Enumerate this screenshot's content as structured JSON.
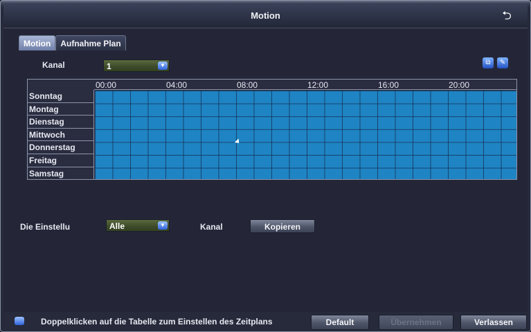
{
  "window": {
    "title": "Motion",
    "back_icon": "return-arrow-icon"
  },
  "tabs": [
    {
      "label": "Motion",
      "active": true
    },
    {
      "label": "Aufnahme Plan",
      "active": false
    }
  ],
  "channel": {
    "label": "Kanal",
    "value": "1"
  },
  "toolbar_icons": [
    "copy-schedule-icon",
    "edit-schedule-icon"
  ],
  "schedule": {
    "time_labels": [
      "00:00",
      "04:00",
      "08:00",
      "12:00",
      "16:00",
      "20:00"
    ],
    "days": [
      "Sonntag",
      "Montag",
      "Dienstag",
      "Mittwoch",
      "Donnerstag",
      "Freitag",
      "Samstag"
    ],
    "cell_color": "#1f84c3"
  },
  "settings": {
    "label": "Die Einstellu",
    "value": "Alle",
    "channel_label": "Kanal",
    "copy_button": "Kopieren"
  },
  "footer": {
    "hint": "Doppelklicken auf die Tabelle zum Einstellen des Zeitplans",
    "default_button": "Default",
    "apply_button": "Übernehmen",
    "exit_button": "Verlassen"
  }
}
